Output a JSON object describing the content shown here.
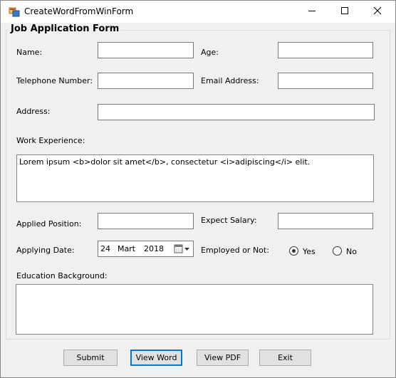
{
  "window": {
    "title": "CreateWordFromWinForm"
  },
  "form": {
    "group_title": "Job Application Form",
    "labels": {
      "name": "Name:",
      "age": "Age:",
      "telephone": "Telephone Number:",
      "email": "Email Address:",
      "address": "Address:",
      "work_experience": "Work Experience:",
      "applied_position": "Applied Position:",
      "expect_salary": "Expect Salary:",
      "applying_date": "Applying Date:",
      "employed": "Employed or Not:",
      "education": "Education Background:"
    },
    "values": {
      "name": "",
      "age": "",
      "telephone": "",
      "email": "",
      "address": "",
      "work_experience": "Lorem ipsum <b>dolor sit amet</b>, consectetur <i>adipiscing</i> elit.",
      "applied_position": "",
      "expect_salary": "",
      "education": ""
    },
    "applying_date": {
      "day": "24",
      "month": "Mart",
      "year": "2018"
    },
    "employed_options": [
      {
        "label": "Yes",
        "selected": true
      },
      {
        "label": "No",
        "selected": false
      }
    ]
  },
  "buttons": {
    "submit": "Submit",
    "view_word": "View Word",
    "view_pdf": "View PDF",
    "exit": "Exit"
  },
  "icons": {
    "app": "app-icon",
    "minimize": "minimize-icon",
    "maximize": "maximize-icon",
    "close": "close-icon",
    "calendar": "calendar-icon"
  }
}
